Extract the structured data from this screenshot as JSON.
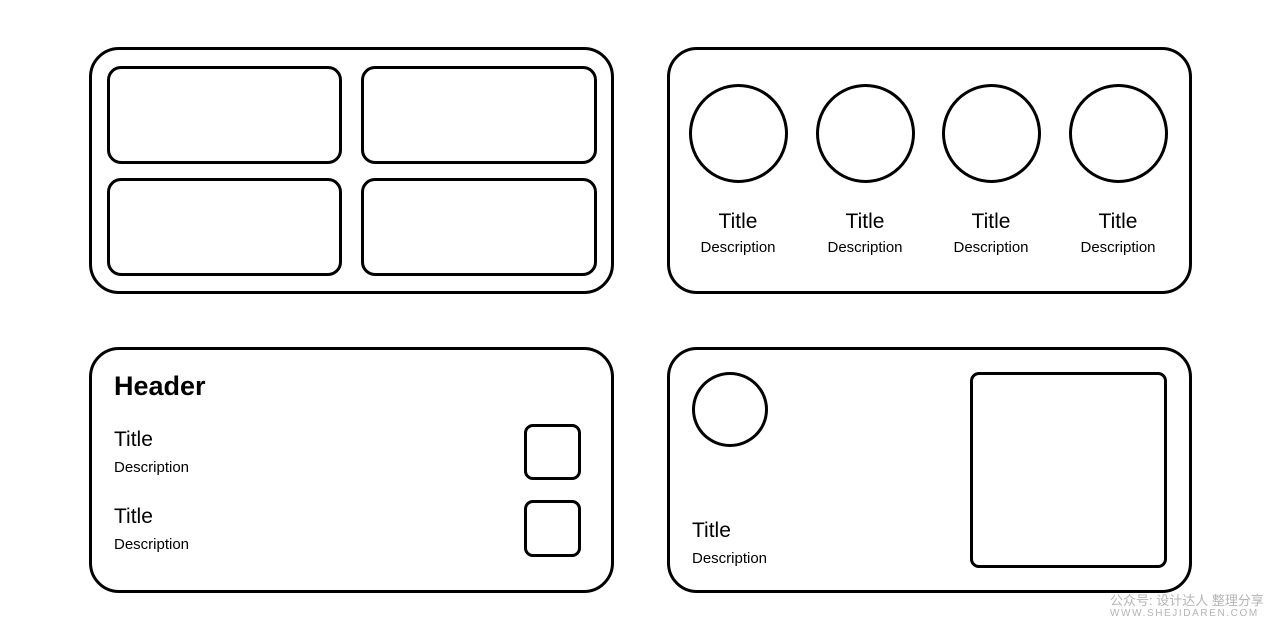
{
  "grid_card": {
    "tiles": 4
  },
  "avatars_card": {
    "items": [
      {
        "title": "Title",
        "description": "Description"
      },
      {
        "title": "Title",
        "description": "Description"
      },
      {
        "title": "Title",
        "description": "Description"
      },
      {
        "title": "Title",
        "description": "Description"
      }
    ]
  },
  "list_card": {
    "header": "Header",
    "items": [
      {
        "title": "Title",
        "description": "Description"
      },
      {
        "title": "Title",
        "description": "Description"
      }
    ]
  },
  "media_card": {
    "title": "Title",
    "description": "Description"
  },
  "watermark": {
    "line1": "公众号: 设计达人 整理分享",
    "line2": "WWW.SHEJIDAREN.COM"
  }
}
